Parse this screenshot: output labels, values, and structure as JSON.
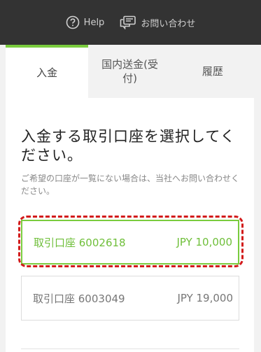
{
  "header": {
    "help_label": "Help",
    "contact_label": "お問い合わせ"
  },
  "tabs": [
    {
      "label": "入金"
    },
    {
      "label": "国内送金(受付)"
    },
    {
      "label": "履歴"
    }
  ],
  "main": {
    "title": "入金する取引口座を選択してください。",
    "note": "ご希望の口座が一覧にない場合は、当社へお問い合わせください。"
  },
  "accounts": [
    {
      "name": "取引口座 6002618",
      "balance": "JPY 10,000"
    },
    {
      "name": "取引口座 6003049",
      "balance": "JPY 19,000"
    }
  ],
  "colors": {
    "accent": "#7acc3e",
    "header_bg": "#333333",
    "highlight": "#d21b1b"
  }
}
